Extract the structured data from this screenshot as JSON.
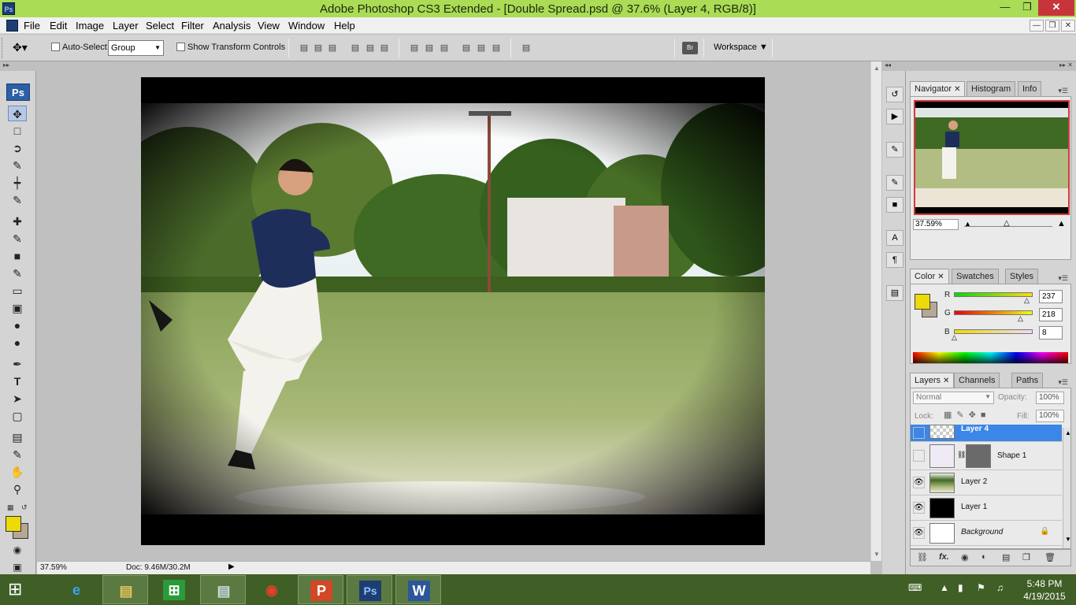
{
  "window": {
    "title": "Adobe Photoshop CS3 Extended - [Double Spread.psd @ 37.6% (Layer 4, RGB/8)]",
    "app_icon": "Ps",
    "controls": [
      "minimize-icon",
      "maximize-icon",
      "close-icon"
    ]
  },
  "menu": [
    "File",
    "Edit",
    "Image",
    "Layer",
    "Select",
    "Filter",
    "Analysis",
    "View",
    "Window",
    "Help"
  ],
  "options_bar": {
    "auto_select_label": "Auto-Select:",
    "auto_select_value": "Group",
    "show_transform_label": "Show Transform Controls",
    "bridge_label": "Br",
    "workspace_label": "Workspace"
  },
  "toolbox": {
    "logo": "Ps",
    "tools": [
      "move-tool-icon",
      "marquee-tool-icon",
      "lasso-tool-icon",
      "quick-selection-tool-icon",
      "crop-tool-icon",
      "slice-tool-icon",
      "healing-brush-tool-icon",
      "brush-tool-icon",
      "clone-stamp-tool-icon",
      "history-brush-tool-icon",
      "eraser-tool-icon",
      "gradient-tool-icon",
      "blur-tool-icon",
      "dodge-tool-icon",
      "pen-tool-icon",
      "type-tool-icon",
      "path-selection-tool-icon",
      "shape-tool-icon",
      "notes-tool-icon",
      "eyedropper-tool-icon",
      "hand-tool-icon",
      "zoom-tool-icon"
    ],
    "type_tool_glyph": "T",
    "foreground_color": "#edda08",
    "background_color": "#b7a796"
  },
  "status_bar": {
    "zoom": "37.59%",
    "doc_size": "Doc: 9.46M/30.2M"
  },
  "navigator": {
    "tabs": [
      "Navigator",
      "Histogram",
      "Info"
    ],
    "zoom": "37.59%"
  },
  "color_panel": {
    "tabs": [
      "Color",
      "Swatches",
      "Styles"
    ],
    "channels": [
      {
        "label": "R",
        "value": "237"
      },
      {
        "label": "G",
        "value": "218"
      },
      {
        "label": "B",
        "value": "8"
      }
    ]
  },
  "layers_panel": {
    "tabs": [
      "Layers",
      "Channels",
      "Paths"
    ],
    "blend_mode": "Normal",
    "opacity_label": "Opacity:",
    "opacity": "100%",
    "lock_label": "Lock:",
    "fill_label": "Fill:",
    "fill": "100%",
    "layers": [
      {
        "name": "Layer 4",
        "selected": true,
        "visible": false
      },
      {
        "name": "Shape 1",
        "selected": false,
        "visible": false
      },
      {
        "name": "Layer 2",
        "selected": false,
        "visible": true
      },
      {
        "name": "Layer 1",
        "selected": false,
        "visible": true
      },
      {
        "name": "Background",
        "selected": false,
        "visible": true,
        "locked": true
      }
    ],
    "footer_icons": [
      "link-icon",
      "fx-icon",
      "mask-icon",
      "adjustment-icon",
      "group-icon",
      "new-layer-icon",
      "trash-icon"
    ],
    "footer_fx": "fx."
  },
  "taskbar": {
    "apps": [
      "internet-explorer-icon",
      "file-explorer-icon",
      "store-icon",
      "remote-desktop-icon",
      "chrome-icon",
      "powerpoint-icon",
      "photoshop-icon",
      "word-icon"
    ],
    "ps_label": "Ps",
    "word_label": "W",
    "time": "5:48 PM",
    "date": "4/19/2015"
  }
}
